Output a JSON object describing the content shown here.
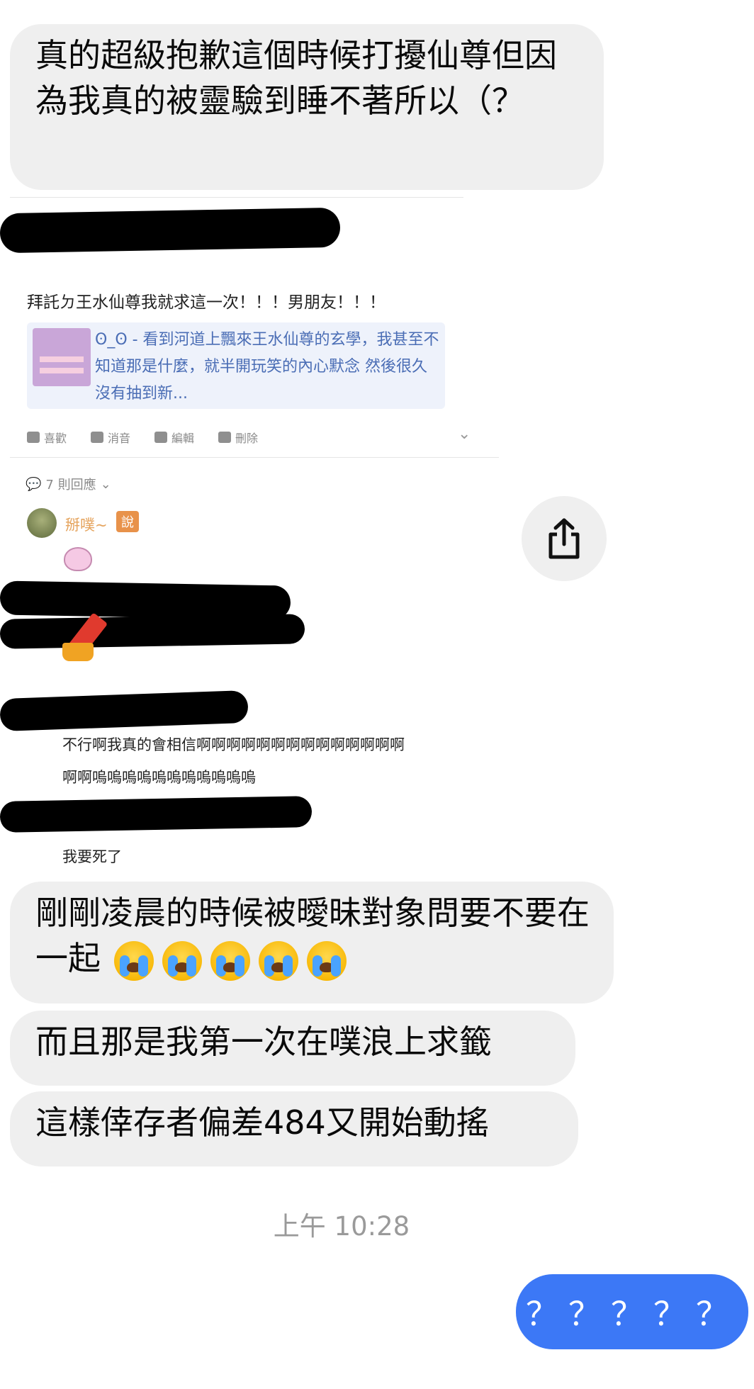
{
  "messages_in": [
    {
      "text": "真的超級抱歉這個時候打擾仙尊但因為我真的被靈驗到睡不著所以（？"
    },
    {
      "text": "剛剛凌晨的時候被曖昧對象問要不要在一起"
    },
    {
      "text": "而且那是我第一次在噗浪上求籤"
    },
    {
      "text": "這樣倖存者偏差484又開始動搖"
    }
  ],
  "emoji_icon": "loudly-crying-face",
  "screenshot": {
    "post_text": "拜託ㄉ王水仙尊我就求這一次！！！男朋友！！！",
    "card_text": "ʘ_ʘ - 看到河道上飄來王水仙尊的玄學，我甚至不知道那是什麼，就半開玩笑的內心默念 然後很久沒有抽到新...",
    "actions": {
      "like": "喜歡",
      "mute": "消音",
      "edit": "編輯",
      "delete": "刪除"
    },
    "reply_count": "7 則回應",
    "username": "掰噗~",
    "says_badge": "說",
    "reply1_line1": "不行啊我真的會相信啊啊啊啊啊啊啊啊啊啊啊啊啊啊",
    "reply1_line2": "啊啊嗚嗚嗚嗚嗚嗚嗚嗚嗚嗚嗚",
    "reply2": "我要死了"
  },
  "timestamp": "上午 10:28",
  "message_out": "？？？？？",
  "colors": {
    "out_bubble": "#3c78f6",
    "in_bubble": "#efefef",
    "link": "#4a6db5",
    "plurk_orange": "#e8924a"
  }
}
